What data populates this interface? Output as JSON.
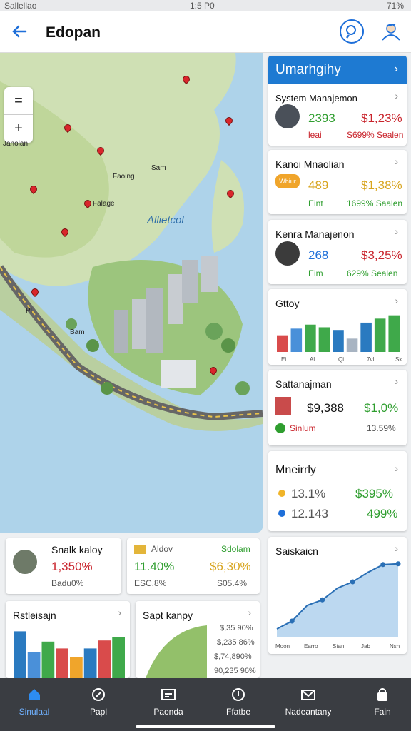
{
  "status_bar": {
    "left": "Sallellao",
    "time": "1:5 P0",
    "battery": "71%"
  },
  "app_bar": {
    "title": "Edopan",
    "icons": [
      "back-arrow-icon",
      "search-icon",
      "profile-icon"
    ]
  },
  "map": {
    "water_label": "Allietcol",
    "place_labels": [
      "Janolan",
      "Faoing",
      "Falage",
      "Bam",
      "Sam",
      "Pl"
    ],
    "zoom_in": "+",
    "zoom_out": "=",
    "colors": {
      "water": "#aed3ea",
      "land": "#cfe0b4",
      "pin": "#d9262b"
    }
  },
  "right_panel": {
    "header": "Umarhgihy",
    "cards": [
      {
        "title": "System Manajemon",
        "value": "2393",
        "change": "$1,23%",
        "sub_left": "leai",
        "sub_right": "S699% Sealen"
      },
      {
        "title": "Kanoi Mnaolian",
        "value": "489",
        "change": "$1,38%",
        "sub_left": "Eint",
        "sub_right": "1699% Saalen",
        "badge": "Whiur"
      },
      {
        "title": "Kenra Manajenon",
        "value": "268",
        "change": "$3,25%",
        "sub_left": "Eim",
        "sub_right": "629% Sealen"
      },
      {
        "title": "Gttoy",
        "bar_labels": [
          "Ei",
          "Al",
          "Qi",
          "7vl",
          "Sk"
        ]
      },
      {
        "title": "Sattanajman",
        "value": "$9,388",
        "change": "$1,0%",
        "sub_left": "Sinlum",
        "sub_right": "13.59%"
      },
      {
        "title": "Mneirrly",
        "rows": [
          {
            "left": "13.1%",
            "right": "$395%"
          },
          {
            "left": "12.143",
            "right": "499%"
          }
        ]
      },
      {
        "title": "Saiskaicn",
        "x_labels": [
          "Moon",
          "Earro",
          "Stan",
          "Jab",
          "Nsn"
        ]
      }
    ]
  },
  "bottom_cards": [
    {
      "title": "Snalk kaloy",
      "value": "1,350%",
      "sub": "Badu0%"
    },
    {
      "title": "Aldov",
      "value": "11.40%",
      "right_title": "Sdolam",
      "right_value": "$6,30%",
      "sub": "ESC.8%",
      "sub_right": "S05.4%"
    },
    {
      "title": "Rstleisajn"
    },
    {
      "title": "Sapt kanpy",
      "values": [
        "$,35 90%",
        "$,235 86%",
        "$,74,890%",
        "90,235 96%"
      ]
    }
  ],
  "chart_data": [
    {
      "type": "bar",
      "title": "Gttoy",
      "categories": [
        "Ei",
        "Al",
        "Qi",
        "7vl",
        "Sk"
      ],
      "series": [
        {
          "values": [
            25,
            35,
            41,
            37,
            33,
            20,
            44,
            50,
            55
          ]
        }
      ]
    },
    {
      "type": "line",
      "title": "Saiskaicn",
      "categories": [
        "Moon",
        "Earro",
        "Stan",
        "Jab",
        "Nsn"
      ],
      "series": [
        {
          "values": [
            10,
            20,
            40,
            47,
            62,
            70,
            82,
            92,
            93
          ]
        }
      ]
    },
    {
      "type": "bar",
      "title": "Rstleisajn",
      "series": [
        {
          "values": [
            82,
            45,
            64,
            52,
            37,
            52,
            66,
            72
          ]
        }
      ]
    }
  ],
  "bottom_nav": [
    {
      "label": "Sinulaal",
      "icon": "home-icon",
      "active": true
    },
    {
      "label": "Papl",
      "icon": "compass-icon"
    },
    {
      "label": "Paonda",
      "icon": "chart-icon"
    },
    {
      "label": "Ffatbe",
      "icon": "location-icon"
    },
    {
      "label": "Nadeantany",
      "icon": "mail-icon"
    },
    {
      "label": "Fain",
      "icon": "lock-icon"
    }
  ],
  "colors": {
    "accent": "#1e7ad2",
    "positive": "#2f9e2f",
    "negative": "#c9242c",
    "gold": "#d8a51f",
    "nav_bg": "#3a3d42"
  }
}
